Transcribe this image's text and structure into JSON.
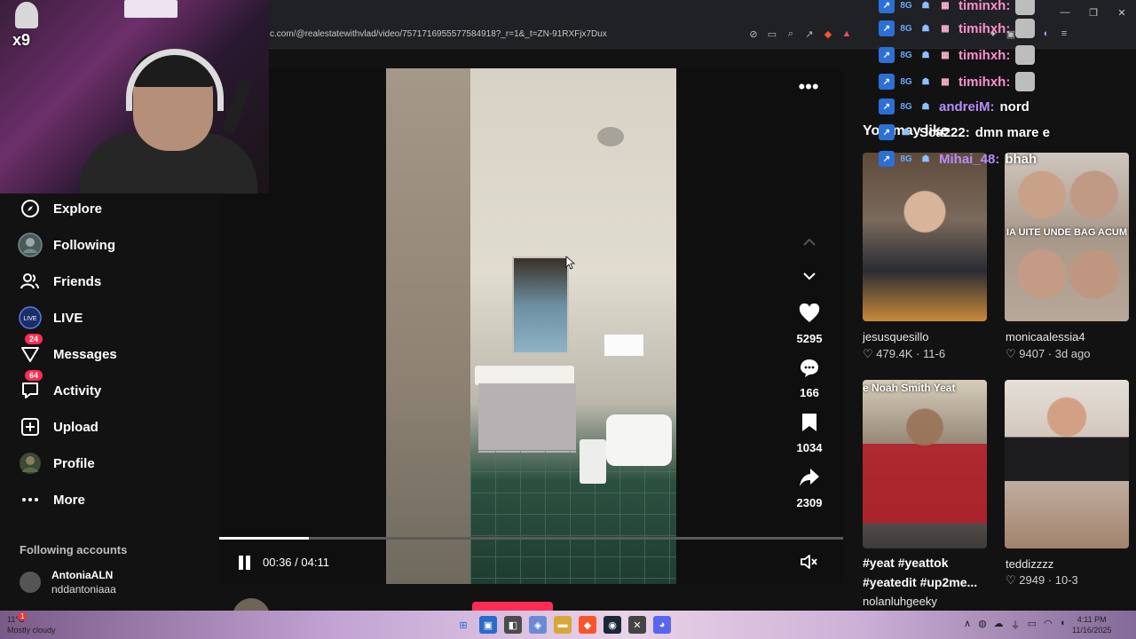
{
  "browser": {
    "url": "c.com/@realestatewithvlad/video/7571716955577584918?_r=1&_t=ZN-91RXFjx7Dux"
  },
  "webcam": {
    "badge": "x9"
  },
  "nav": {
    "items": [
      {
        "label": "Explore",
        "icon": "compass-icon"
      },
      {
        "label": "Following",
        "icon": "avatar-icon"
      },
      {
        "label": "Friends",
        "icon": "friends-icon"
      },
      {
        "label": "LIVE",
        "icon": "live-icon"
      },
      {
        "label": "Messages",
        "icon": "messages-icon",
        "badge": "24"
      },
      {
        "label": "Activity",
        "icon": "activity-icon",
        "badge": "64"
      },
      {
        "label": "Upload",
        "icon": "upload-icon"
      },
      {
        "label": "Profile",
        "icon": "profile-icon"
      },
      {
        "label": "More",
        "icon": "more-icon"
      }
    ],
    "following_header": "Following accounts",
    "following_accounts": [
      {
        "name": "AntoniaALN",
        "handle": "nddantoniaaa"
      }
    ]
  },
  "video": {
    "time": "00:36 / 04:11",
    "progress_fraction": 0.143,
    "likes": "5295",
    "comments": "166",
    "bookmarks": "1034",
    "shares": "2309",
    "author": "realestatewithvlad"
  },
  "recommend": {
    "title": "You may like",
    "tiles": [
      {
        "user": "jesusquesillo",
        "stats": "♡ 479.4K · 11-6",
        "overlay": ""
      },
      {
        "user": "monicaalessia4",
        "stats": "♡ 9407 · 3d ago",
        "overlay": "IA UITE UNDE BAG ACUM"
      },
      {
        "caption": "#yeat #yeattok #yeatedit #up2me...",
        "user": "nolanluhgeeky",
        "overlay": "e Noah Smith Yeat"
      },
      {
        "user": "teddizzzz",
        "stats": "♡ 2949 · 10-3",
        "overlay": ""
      }
    ]
  },
  "chat": [
    {
      "name": "timinxh:",
      "color": "#ff8fd0",
      "img": true
    },
    {
      "name": "timihxh:",
      "color": "#ff8fd0",
      "img": true
    },
    {
      "name": "timihxh:",
      "color": "#ff8fd0",
      "img": true
    },
    {
      "name": "timihxh:",
      "color": "#ff8fd0",
      "img": true
    },
    {
      "name": "andreiM:",
      "color": "#b98cff",
      "msg": "nord"
    },
    {
      "name": "Sca222:",
      "color": "#ffffff",
      "msg": "dmn mare e"
    },
    {
      "name": "Mihai_48:",
      "color": "#b98cff",
      "msg": "bhah"
    }
  ],
  "taskbar": {
    "temp": "11°C",
    "weather": "Mostly cloudy",
    "time": "4:11 PM",
    "date": "11/16/2025",
    "notif_count": "1"
  }
}
